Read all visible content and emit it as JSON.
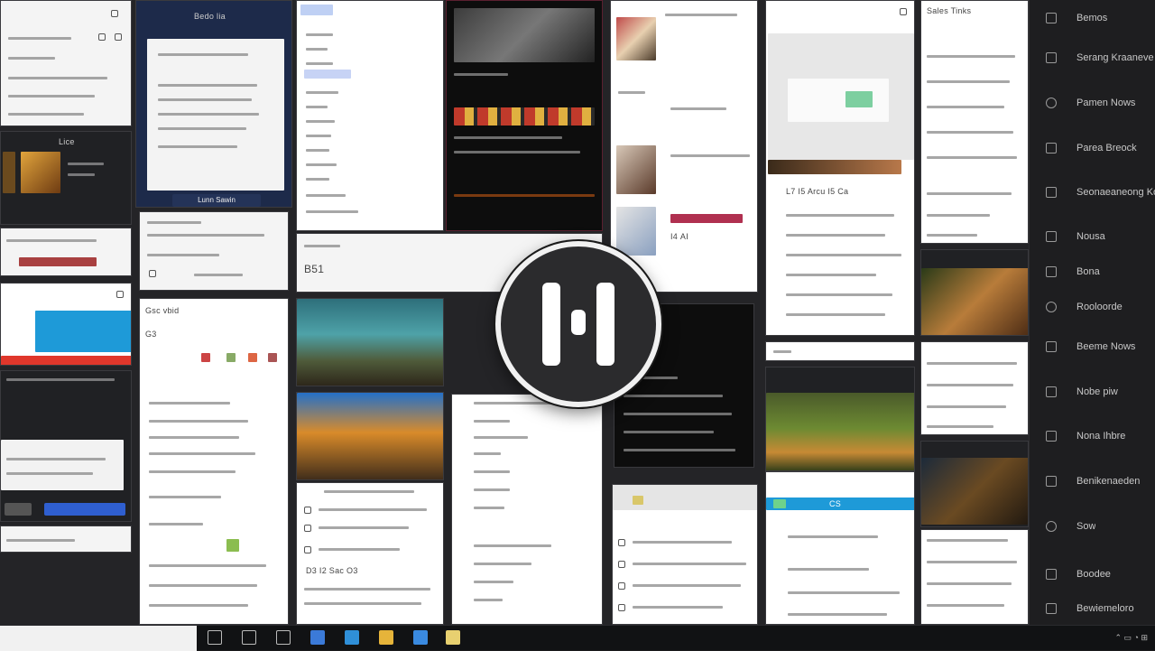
{
  "colors": {
    "accent_blue": "#2f5fd0",
    "accent_red": "#e0372b",
    "accent_cyan": "#1e9ad8",
    "panel": "#1e1e20"
  },
  "tiles": {
    "mail_header": "Sales Tinks",
    "dark_caption": "Lice",
    "doc_title": "Bedo lia",
    "doc_button": "Lunn Sawin",
    "list_status": "B51",
    "forum_title": "Gsc vbid",
    "forum_count": "G3",
    "news_price": "I4 AI",
    "feed_heading": "L7 I5 Arcu I5 Ca",
    "chat_tag": "CS",
    "mid_footer": "D3 I2 Sac O3"
  },
  "logo": {
    "name": "H-mark",
    "glyph": "H"
  },
  "sidebar": {
    "items": [
      {
        "label": "Bemos",
        "icon": "grid-icon"
      },
      {
        "label": "Serang Kraaneve",
        "icon": "window-icon"
      },
      {
        "label": "Pamen Nows",
        "icon": "globe-icon"
      },
      {
        "label": "Parea Breock",
        "icon": "window-icon"
      },
      {
        "label": "Seonaeaneong Koen",
        "icon": "window-icon"
      },
      {
        "label": "Nousa",
        "icon": "film-icon"
      },
      {
        "label": "Bona",
        "icon": "box-icon"
      },
      {
        "label": "Rooloorde",
        "icon": "globe-icon"
      },
      {
        "label": "Beeme Nows",
        "icon": "layers-icon"
      },
      {
        "label": "Nobe piw",
        "icon": "window-icon"
      },
      {
        "label": "Nona Ihbre",
        "icon": "apps-icon"
      },
      {
        "label": "Benikenaeden",
        "icon": "window-icon"
      },
      {
        "label": "Sow",
        "icon": "circle-icon"
      },
      {
        "label": "Boodee",
        "icon": "box-icon"
      },
      {
        "label": "Bewiemeloro",
        "icon": "window-icon"
      }
    ]
  },
  "taskbar": {
    "search_placeholder": "",
    "apps": [
      "start-icon",
      "explorer-icon",
      "tasks-icon",
      "mail-icon",
      "browser-icon",
      "folder-icon",
      "store-icon",
      "notes-icon"
    ]
  }
}
